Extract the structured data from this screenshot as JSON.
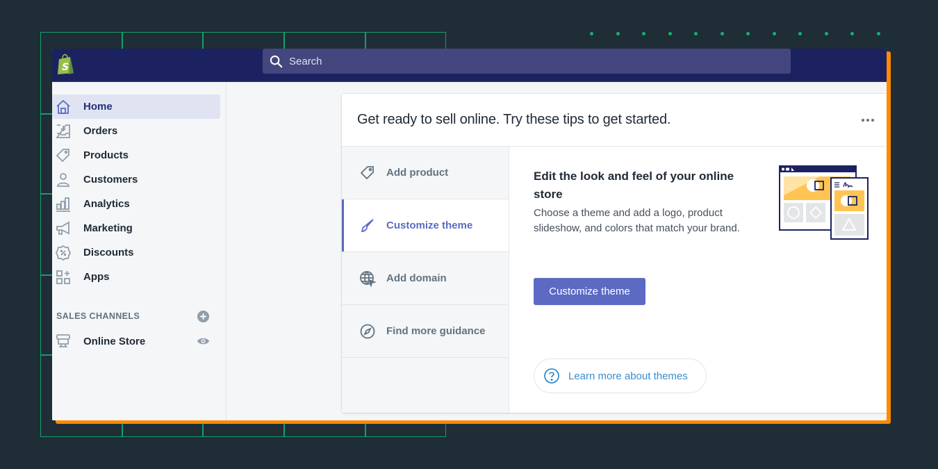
{
  "search": {
    "placeholder": "Search"
  },
  "sidebar": {
    "items": [
      {
        "label": "Home",
        "icon": "home-icon",
        "active": true
      },
      {
        "label": "Orders",
        "icon": "orders-icon",
        "active": false
      },
      {
        "label": "Products",
        "icon": "tag-icon",
        "active": false
      },
      {
        "label": "Customers",
        "icon": "person-icon",
        "active": false
      },
      {
        "label": "Analytics",
        "icon": "bar-chart-icon",
        "active": false
      },
      {
        "label": "Marketing",
        "icon": "megaphone-icon",
        "active": false
      },
      {
        "label": "Discounts",
        "icon": "discount-icon",
        "active": false
      },
      {
        "label": "Apps",
        "icon": "apps-icon",
        "active": false
      }
    ],
    "sales_channels": {
      "title": "SALES CHANNELS",
      "items": [
        {
          "label": "Online Store",
          "icon": "store-icon"
        }
      ]
    }
  },
  "card": {
    "title": "Get ready to sell online. Try these tips to get started.",
    "tips": [
      {
        "label": "Add product",
        "icon": "tag-icon",
        "active": false
      },
      {
        "label": "Customize theme",
        "icon": "paintbrush-icon",
        "active": true
      },
      {
        "label": "Add domain",
        "icon": "globe-icon",
        "active": false
      },
      {
        "label": "Find more guidance",
        "icon": "compass-icon",
        "active": false
      }
    ],
    "detail": {
      "heading": "Edit the look and feel of your online store",
      "body": "Choose a theme and add a logo, product slideshow, and colors that match your brand.",
      "button": "Customize theme",
      "learn_more": "Learn more about themes"
    }
  },
  "colors": {
    "background": "#1f2d36",
    "topbar": "#1c2260",
    "search": "#43467f",
    "accent": "#5c6ac4",
    "link": "#3b8dc9",
    "frame": "#ff8a00",
    "grid": "#12a06a",
    "illustration": "#ffc453"
  }
}
